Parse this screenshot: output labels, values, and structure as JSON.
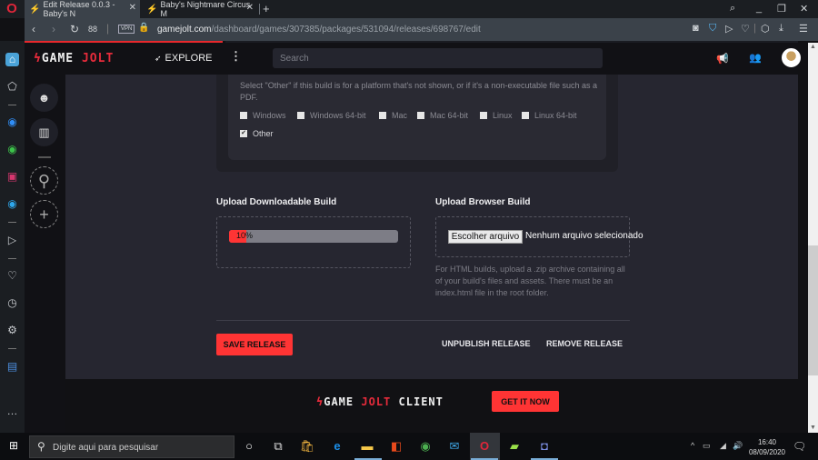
{
  "browser": {
    "tabs": [
      {
        "title": "Edit Release 0.0.3 - Baby's N",
        "active": true
      },
      {
        "title": "Baby's Nightmare Circus M",
        "active": false
      }
    ],
    "new_tab": "+",
    "close_glyph": "✕",
    "url_domain": "gamejolt.com",
    "url_path": "/dashboard/games/307385/packages/531094/releases/698767/edit",
    "vpn_label": "VPN",
    "page_load_progress_percent": 25,
    "window_controls": [
      "search",
      "minimize",
      "restore",
      "close"
    ],
    "address_icons": [
      "camera-icon",
      "shield-icon",
      "send-icon",
      "heart-icon",
      "cube-icon",
      "download-icon",
      "settings-icon"
    ]
  },
  "opera_sidebar": {
    "items": [
      "home",
      "bookmarks",
      "messenger",
      "whatsapp",
      "instagram",
      "twitter",
      "flow",
      "favorites",
      "history",
      "settings",
      "extension",
      "more"
    ]
  },
  "header": {
    "logo_game": "GAME",
    "logo_jolt": "JOLT",
    "explore_label": "EXPLORE",
    "search_placeholder": "Search"
  },
  "platforms": {
    "help_text": "Select \"Other\" if this build is for a platform that's not shown, or if it's a non-executable file such as a PDF.",
    "options": [
      {
        "label": "Windows",
        "checked": false
      },
      {
        "label": "Windows 64-bit",
        "checked": false
      },
      {
        "label": "Mac",
        "checked": false
      },
      {
        "label": "Mac 64-bit",
        "checked": false
      },
      {
        "label": "Linux",
        "checked": false
      },
      {
        "label": "Linux 64-bit",
        "checked": false
      },
      {
        "label": "Other",
        "checked": true
      }
    ]
  },
  "upload_downloadable": {
    "title": "Upload Downloadable Build",
    "progress_percent": 10,
    "progress_label": "10%"
  },
  "upload_browser": {
    "title": "Upload Browser Build",
    "choose_file_label": "Escolher arquivo",
    "no_file_label": "Nenhum arquivo selecionado",
    "help_text": "For HTML builds, upload a .zip archive containing all of your build's files and assets. There must be an index.html file in the root folder."
  },
  "actions": {
    "save": "SAVE RELEASE",
    "unpublish": "UNPUBLISH RELEASE",
    "remove": "REMOVE RELEASE"
  },
  "footer": {
    "logo_game": "GAME",
    "logo_jolt": "JOLT",
    "logo_client": "CLIENT",
    "cta": "GET IT NOW"
  },
  "taskbar": {
    "search_placeholder": "Digite aqui para pesquisar",
    "time": "16:40",
    "date": "08/09/2020"
  },
  "colors": {
    "accent": "#ff3434",
    "brand_red": "#e52b3b",
    "page_bg": "#262630",
    "header_bg": "#111115"
  }
}
